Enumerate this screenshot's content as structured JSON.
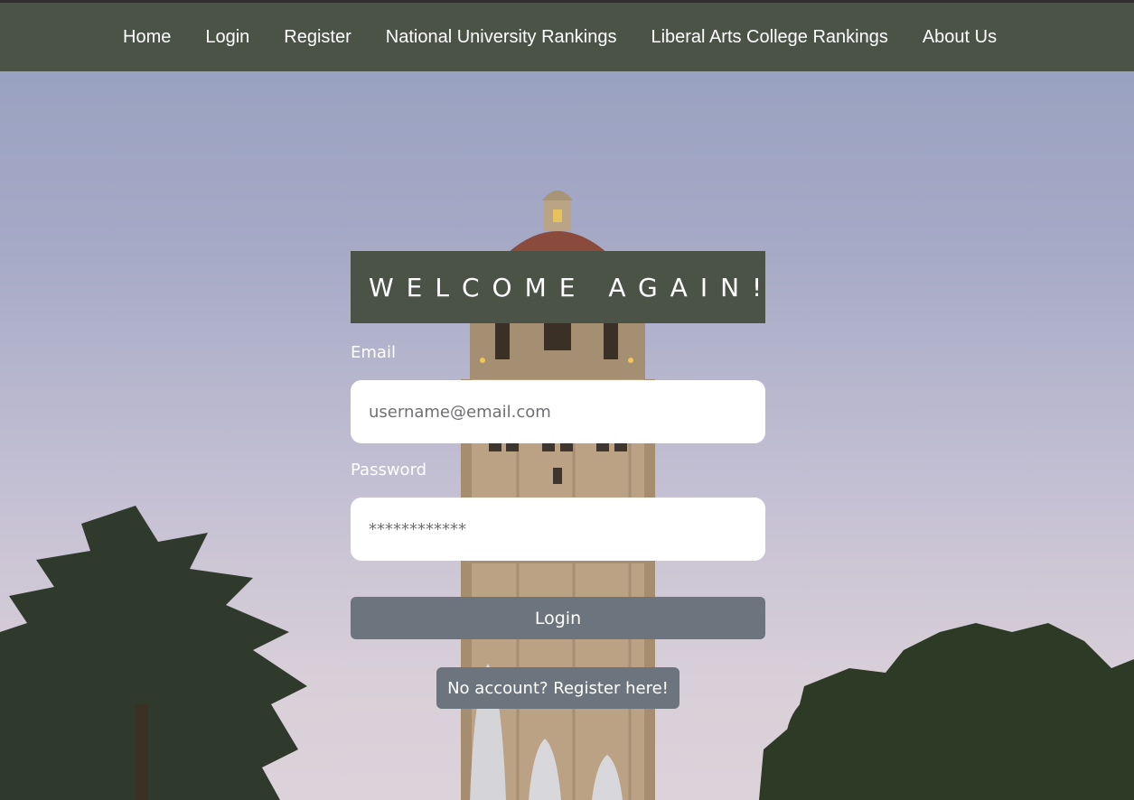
{
  "nav": {
    "items": [
      {
        "label": "Home"
      },
      {
        "label": "Login"
      },
      {
        "label": "Register"
      },
      {
        "label": "National University Rankings"
      },
      {
        "label": "Liberal Arts College Rankings"
      },
      {
        "label": "About Us"
      }
    ]
  },
  "form": {
    "heading": "WELCOME AGAIN!",
    "email_label": "Email",
    "email_placeholder": "username@email.com",
    "password_label": "Password",
    "password_placeholder": "************",
    "login_label": "Login",
    "register_link_label": "No account? Register here!"
  },
  "colors": {
    "navbar": "#4b5347",
    "button": "#6c757d",
    "text": "#ffffff"
  }
}
